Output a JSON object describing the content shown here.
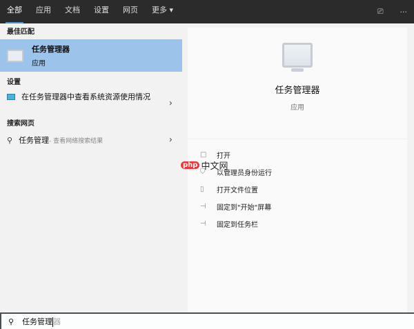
{
  "tabs": [
    {
      "label": "全部",
      "active": true
    },
    {
      "label": "应用"
    },
    {
      "label": "文档"
    },
    {
      "label": "设置"
    },
    {
      "label": "网页"
    },
    {
      "label": "更多 ▾"
    }
  ],
  "topbar_right": {
    "feedback_icon": "feedback-icon",
    "more": "···"
  },
  "left": {
    "best_match_header": "最佳匹配",
    "best_match": {
      "title": "任务管理器",
      "subtitle": "应用"
    },
    "settings_header": "设置",
    "settings_item": "在任务管理器中查看系统资源使用情况",
    "web_header": "搜索网页",
    "web_item": {
      "query": "任务管理",
      "suffix": " - 查看网络搜索结果"
    }
  },
  "right": {
    "title": "任务管理器",
    "subtitle": "应用",
    "actions": [
      {
        "label": "打开",
        "icon": "□"
      },
      {
        "label": "以管理员身份运行",
        "icon": "⛉"
      },
      {
        "label": "打开文件位置",
        "icon": "▯"
      },
      {
        "label": "固定到\"开始\"屏幕",
        "icon": "⊣"
      },
      {
        "label": "固定到任务栏",
        "icon": "⊣"
      }
    ]
  },
  "search": {
    "typed": "任务管理",
    "hint": "器"
  },
  "watermark": {
    "p": "php",
    "c": "中文网"
  }
}
